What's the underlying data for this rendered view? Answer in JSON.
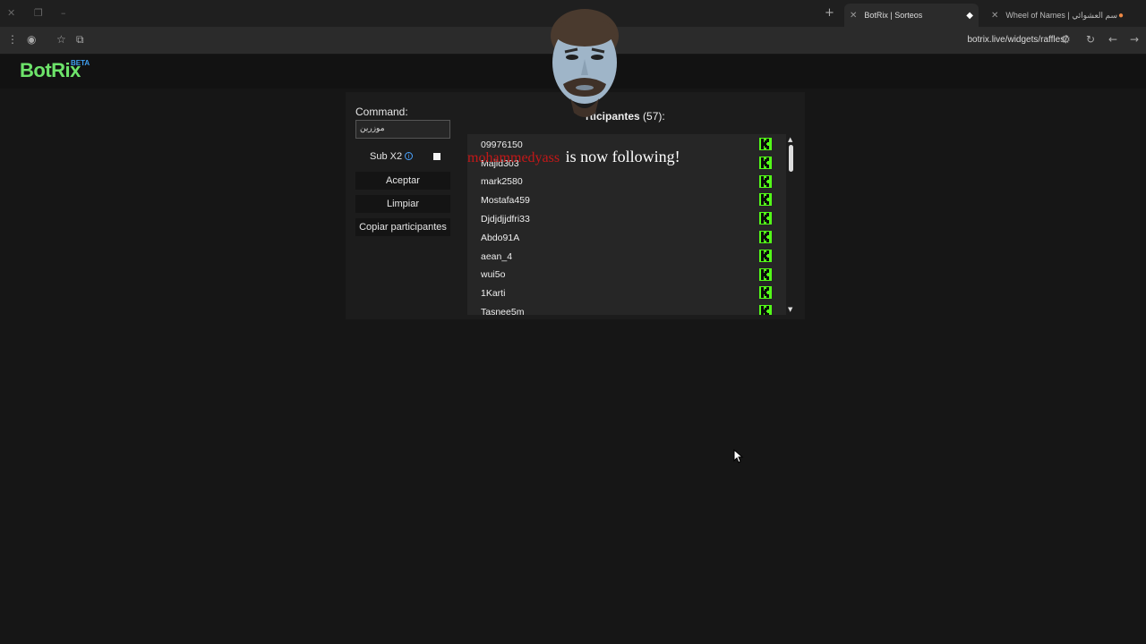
{
  "browser": {
    "tabs": [
      {
        "title": "BotRix | Sorteos",
        "active": true
      },
      {
        "title": "Wheel of Names | اسم العشوائي",
        "active": false
      }
    ],
    "url": "botrix.live/widgets/raffles/"
  },
  "site": {
    "logo": "BotRix",
    "logo_badge": "BETA"
  },
  "raffle": {
    "command_label": "Command:",
    "command_value": "موزرين",
    "sub_label": "Sub X2",
    "info_icon": "i",
    "accept_label": "Aceptar",
    "clear_label": "Limpiar",
    "copy_label": "Copiar participantes",
    "participants_title": "rticipantes",
    "participants_count": "(57):",
    "participants": [
      "09976150",
      "Majid303",
      "mark2580",
      "Mostafa459",
      "Djdjdjjdfri33",
      "Abdo91A",
      "aean_4",
      "wui5o",
      "1Karti",
      "Tasnee5m"
    ]
  },
  "alert": {
    "username": "mohammedyass",
    "message": "is now following!"
  },
  "colors": {
    "kick_green": "#53fc18",
    "logo_green": "#6de36a",
    "alert_red": "#c41818"
  }
}
